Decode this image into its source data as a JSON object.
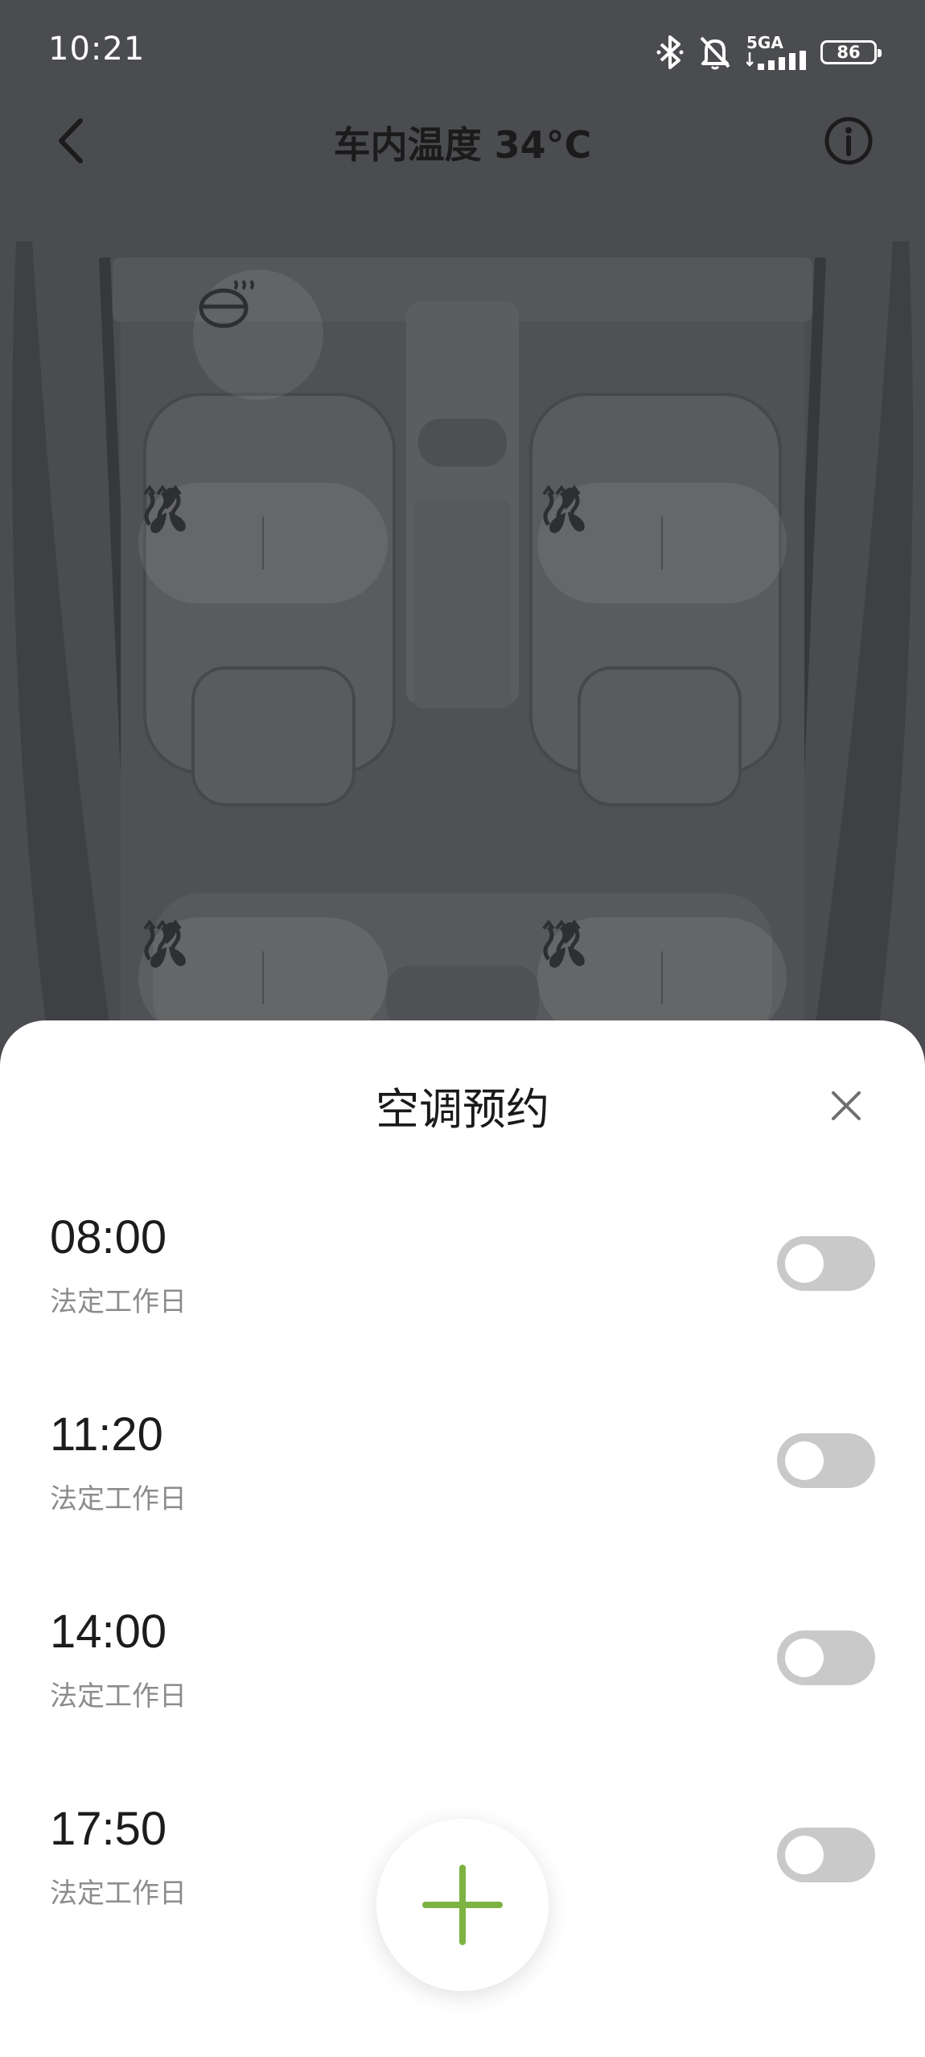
{
  "status_bar": {
    "time": "10:21",
    "network": "5GA",
    "battery": "86",
    "icons": [
      "bluetooth-icon",
      "mute-bell-icon",
      "signal-icon",
      "battery-icon"
    ]
  },
  "header": {
    "title": "车内温度 34°C",
    "back_icon": "chevron-left-icon",
    "info_icon": "info-icon"
  },
  "seat_controls": {
    "controls": [
      "seat-heat-icon",
      "seat-ventilation-icon"
    ],
    "steering_wheel_icon": "steering-wheel-heat-icon"
  },
  "sheet": {
    "title": "空调预约",
    "close_icon": "close-icon",
    "schedules": [
      {
        "time": "08:00",
        "repeat": "法定工作日",
        "enabled": false
      },
      {
        "time": "11:20",
        "repeat": "法定工作日",
        "enabled": false
      },
      {
        "time": "14:00",
        "repeat": "法定工作日",
        "enabled": false
      },
      {
        "time": "17:50",
        "repeat": "法定工作日",
        "enabled": false
      }
    ],
    "add_icon": "plus-icon"
  },
  "colors": {
    "accent": "#7cb342",
    "toggle_off": "#c9c9c9",
    "overlay": "#4b4c4f"
  }
}
